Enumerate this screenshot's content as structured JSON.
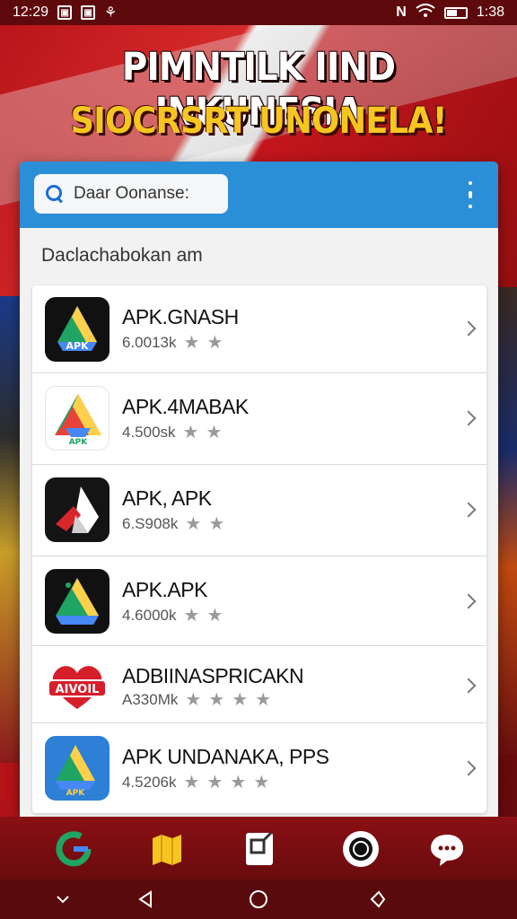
{
  "status_bar": {
    "time_left": "12:29",
    "time_right": "1:38",
    "icon_a": "N",
    "icon_b": "W",
    "icon_c": "⚘"
  },
  "headline": "PIMNTILK IIND INKUNESIA",
  "subheadline": "SIOCRSRT UNONELA!",
  "search": {
    "placeholder": "Daar Oonanse:"
  },
  "section_title": "Daclachabokan am",
  "apps": [
    {
      "name": "APK.GNASH",
      "meta": "6.0013k",
      "stars": 2,
      "icon": "apk-drive-icon"
    },
    {
      "name": "APK.4MABAK",
      "meta": "4.500sk",
      "stars": 2,
      "icon": "apk-drive-icon"
    },
    {
      "name": "APK, APK",
      "meta": "6.S908k",
      "stars": 2,
      "icon": "apk-arrow-icon"
    },
    {
      "name": "APK.APK",
      "meta": "4.6000k",
      "stars": 2,
      "icon": "apk-drive-icon"
    },
    {
      "name": "ADBIINASPRICAKN",
      "meta": "A330Mk",
      "stars": 4,
      "icon": "heart-badge-icon"
    },
    {
      "name": "APK UNDANAKA, PPS",
      "meta": "4.5206k",
      "stars": 4,
      "icon": "apk-drive-icon"
    }
  ],
  "heart_badge_text": "AIVOIL",
  "apk_label": "APK",
  "colors": {
    "accent_blue": "#2b8fd8",
    "brand_red": "#b8141a",
    "headline_yellow": "#f6c620"
  },
  "dock": [
    "google-icon",
    "maps-icon",
    "docs-icon",
    "camera-icon",
    "chat-icon"
  ],
  "nav": [
    "chevron-down-icon",
    "back-icon",
    "home-icon",
    "recents-icon"
  ]
}
